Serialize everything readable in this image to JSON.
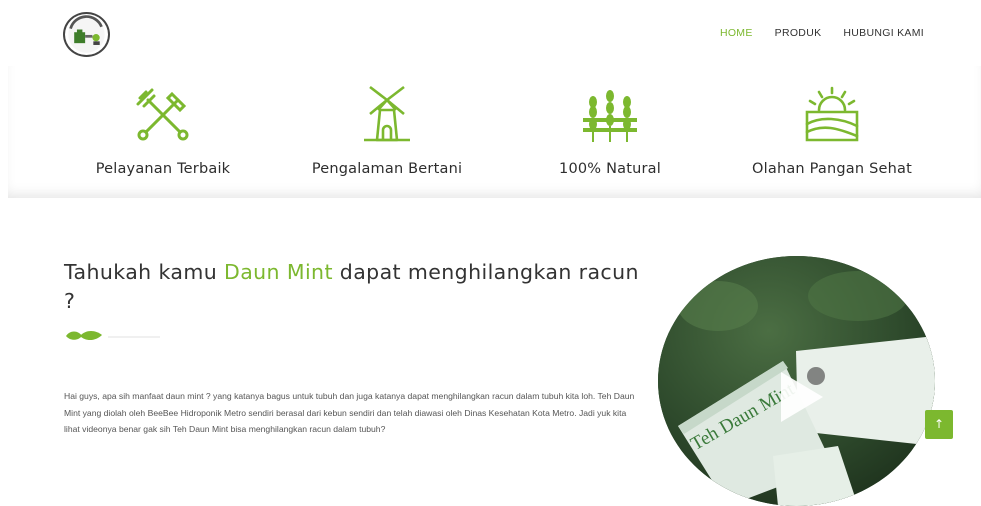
{
  "header": {
    "logo_name": "logo-icon",
    "nav": [
      {
        "label": "HOME",
        "active": true
      },
      {
        "label": "PRODUK",
        "active": false
      },
      {
        "label": "HUBUNGI KAMI",
        "active": false
      }
    ]
  },
  "features": [
    {
      "label": "Pelayanan Terbaik",
      "icon": "shovel-rake-icon"
    },
    {
      "label": "Pengalaman Bertani",
      "icon": "windmill-icon"
    },
    {
      "label": "100% Natural",
      "icon": "wheat-icon"
    },
    {
      "label": "Olahan Pangan Sehat",
      "icon": "sunrise-field-icon"
    }
  ],
  "article": {
    "title_before": "Tahukah kamu ",
    "title_highlight": "Daun Mint",
    "title_after": " dapat menghilangkan racun ?",
    "body": "Hai guys, apa sih manfaat daun mint ? yang katanya bagus untuk tubuh dan juga katanya dapat menghilangkan racun dalam tubuh kita loh. Teh Daun Mint yang diolah oleh BeeBee Hidroponik Metro sendiri berasal dari kebun sendiri dan telah diawasi oleh Dinas Kesehatan Kota Metro. Jadi yuk kita lihat videonya benar gak sih Teh Daun Mint bisa menghilangkan racun dalam tubuh?"
  },
  "video": {
    "package_text": "Teh Daun Mint"
  },
  "back_to_top": "↑",
  "colors": {
    "accent": "#7cb82f",
    "text": "#333333"
  }
}
